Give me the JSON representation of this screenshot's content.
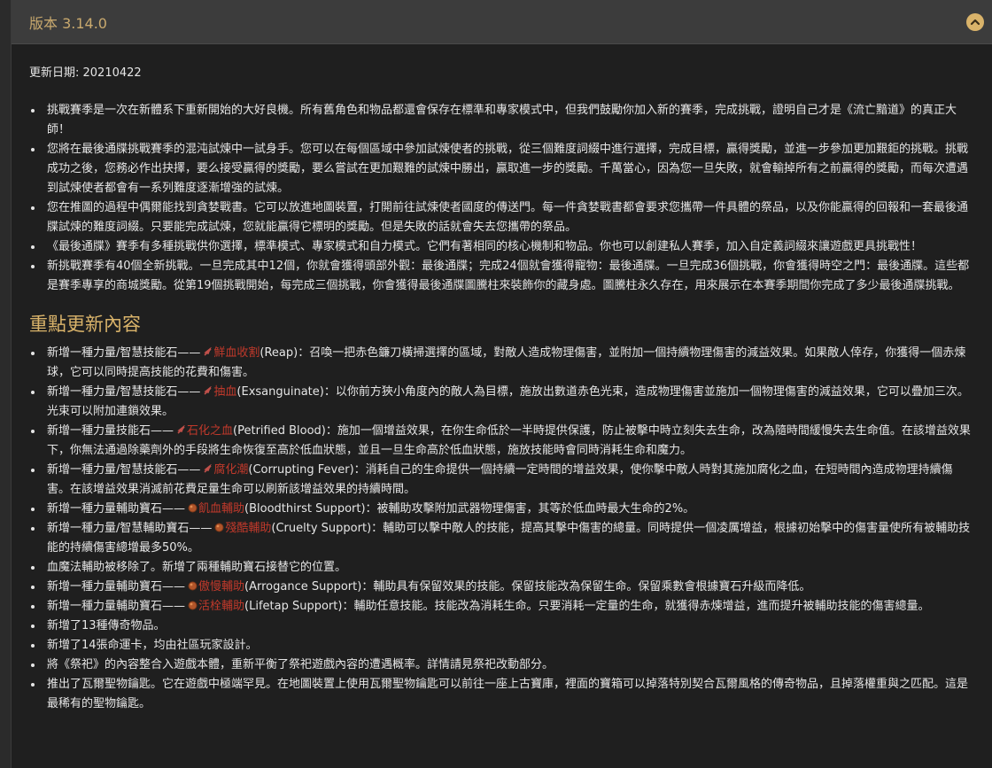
{
  "header": {
    "title": "版本 3.14.0"
  },
  "update_date": "更新日期: 20210422",
  "intro_items": [
    "挑戰賽季是一次在新體系下重新開始的大好良機。所有舊角色和物品都還會保存在標準和專家模式中，但我們鼓勵你加入新的賽季，完成挑戰，證明自己才是《流亡黯道》的真正大師！",
    "您將在最後通牒挑戰賽季的混沌試煉中一試身手。您可以在每個區域中參加試煉使者的挑戰，從三個難度詞綴中進行選擇，完成目標，贏得獎勵，並進一步參加更加艱鉅的挑戰。挑戰成功之後，您務必作出抉擇，要么接受贏得的獎勵，要么嘗試在更加艱難的試煉中勝出，贏取進一步的獎勵。千萬當心，因為您一旦失敗，就會輸掉所有之前贏得的獎勵，而每次遭遇到試煉使者都會有一系列難度逐漸增強的試煉。",
    "您在推圖的過程中偶爾能找到貪婪戰書。它可以放進地圖裝置，打開前往試煉使者國度的傳送門。每一件貪婪戰書都會要求您攜帶一件具體的祭品，以及你能贏得的回報和一套最後通牒試煉的難度詞綴。只要能完成試煉，您就能贏得它標明的獎勵。但是失敗的話就會失去您攜帶的祭品。",
    "《最後通牒》賽季有多種挑戰供你選擇，標準模式、專家模式和自力模式。它們有著相同的核心機制和物品。你也可以創建私人賽季，加入自定義詞綴來讓遊戲更具挑戰性！",
    "新挑戰賽季有40個全新挑戰。一旦完成其中12個，你就會獲得頭部外觀：最後通牒；完成24個就會獲得寵物：最後通牒。一旦完成36個挑戰，你會獲得時空之門：最後通牒。這些都是賽季專享的商城獎勵。從第19個挑戰開始，每完成三個挑戰，你會獲得最後通牒圖騰柱來裝飾你的藏身處。圖騰柱永久存在，用來展示在本賽季期間你完成了多少最後通牒挑戰。"
  ],
  "section_title": "重點更新內容",
  "highlights": [
    {
      "pre": "新增一種力量/智慧技能石——",
      "skill": "鮮血收割",
      "post": "(Reap)：召喚一把赤色鐮刀橫掃選擇的區域，對敵人造成物理傷害，並附加一個持續物理傷害的減益效果。如果敵人倖存，你獲得一個赤煉球，它可以同時提高技能的花費和傷害。",
      "gem": "red"
    },
    {
      "pre": "新增一種力量/智慧技能石——",
      "skill": "抽血",
      "post": "(Exsanguinate)：以你前方狹小角度內的敵人為目標，施放出數道赤色光束，造成物理傷害並施加一個物理傷害的減益效果，它可以疊加三次。光束可以附加連鎖效果。",
      "gem": "red"
    },
    {
      "pre": "新增一種力量技能石——",
      "skill": "石化之血",
      "post": "(Petrified Blood)：施加一個增益效果，在你生命低於一半時提供保護，防止被擊中時立刻失去生命，改為隨時間緩慢失去生命值。在該增益效果下，你無法通過除藥劑外的手段將生命恢復至高於低血狀態，並且一旦生命高於低血狀態，施放技能時會同時消耗生命和魔力。",
      "gem": "red"
    },
    {
      "pre": "新增一種力量/智慧技能石——",
      "skill": "腐化潮",
      "post": "(Corrupting Fever)：消耗自己的生命提供一個持續一定時間的增益效果，使你擊中敵人時對其施加腐化之血，在短時間內造成物理持續傷害。在該增益效果消滅前花費足量生命可以刷新該增益效果的持續時間。",
      "gem": "red"
    },
    {
      "pre": "新增一種力量輔助寶石——",
      "skill": "飢血輔助",
      "post": "(Bloodthirst Support)：被輔助攻擊附加武器物理傷害，其等於低血時最大生命的2%。",
      "gem": "orange"
    },
    {
      "pre": "新增一種力量/智慧輔助寶石——",
      "skill": "殘酷輔助",
      "post": "(Cruelty Support)：輔助可以擊中敵人的技能，提高其擊中傷害的總量。同時提供一個凌厲增益，根據初始擊中的傷害量使所有被輔助技能的持續傷害總增最多50%。",
      "gem": "orange"
    },
    {
      "pre": "血魔法輔助被移除了。新增了兩種輔助寶石接替它的位置。",
      "skill": "",
      "post": "",
      "gem": ""
    },
    {
      "pre": "新增一種力量輔助寶石——",
      "skill": "傲慢輔助",
      "post": "(Arrogance Support)：輔助具有保留效果的技能。保留技能改為保留生命。保留乘數會根據寶石升級而降低。",
      "gem": "orange"
    },
    {
      "pre": "新增一種力量輔助寶石——",
      "skill": "活栓輔助",
      "post": "(Lifetap Support)：輔助任意技能。技能改為消耗生命。只要消耗一定量的生命，就獲得赤煉增益，進而提升被輔助技能的傷害總量。",
      "gem": "orange"
    },
    {
      "pre": "新增了13種傳奇物品。",
      "skill": "",
      "post": "",
      "gem": ""
    },
    {
      "pre": "新增了14張命運卡，均由社區玩家設計。",
      "skill": "",
      "post": "",
      "gem": ""
    },
    {
      "pre": "將《祭祀》的內容整合入遊戲本體，重新平衡了祭祀遊戲內容的遭遇概率。詳情請見祭祀改動部分。",
      "skill": "",
      "post": "",
      "gem": ""
    },
    {
      "pre": "推出了瓦爾聖物鑰匙。它在遊戲中極端罕見。在地圖裝置上使用瓦爾聖物鑰匙可以前往一座上古寶庫，裡面的寶箱可以掉落特別契合瓦爾風格的傳奇物品，且掉落權重與之匹配。這是最稀有的聖物鑰匙。",
      "skill": "",
      "post": "",
      "gem": ""
    }
  ],
  "colors": {
    "accent": "#d9b36a",
    "skill": "#c0392b"
  }
}
